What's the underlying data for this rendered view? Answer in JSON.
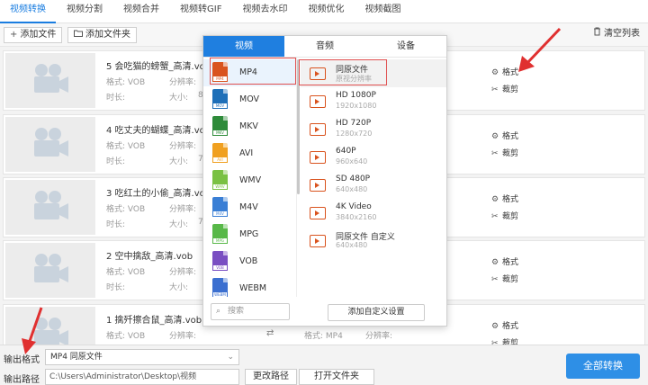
{
  "tabs": [
    "视频转换",
    "视频分割",
    "视频合并",
    "视频转GIF",
    "视频去水印",
    "视频优化",
    "视频截图"
  ],
  "toolbar": {
    "add_file": "添加文件",
    "add_folder": "添加文件夹",
    "clear_list": "清空列表"
  },
  "files": [
    {
      "name": "5 会吃猫的螃蟹_高清.vob",
      "format_label": "格式: VOB",
      "resolution_label": "分辨率:",
      "duration_label": "时长:",
      "size_label": "大小:",
      "size_partial": "8"
    },
    {
      "name": "4 吃丈夫的蝴蝶_高清.vob",
      "format_label": "格式: VOB",
      "resolution_label": "分辨率:",
      "duration_label": "时长:",
      "size_label": "大小:",
      "size_partial": "7"
    },
    {
      "name": "3 吃红土的小偷_高清.vob",
      "format_label": "格式: VOB",
      "resolution_label": "分辨率:",
      "duration_label": "时长:",
      "size_label": "大小:",
      "size_partial": "7"
    },
    {
      "name": "2 空中擒敌_高清.vob",
      "format_label": "格式: VOB",
      "resolution_label": "分辨率:",
      "duration_label": "时长:",
      "size_label": "大小:",
      "size_partial": ""
    },
    {
      "name": "1 擒歼擦合鼠_高清.vob",
      "format_label": "格式: VOB",
      "resolution_label": "分辨率:",
      "duration_label": "",
      "size_label": "",
      "size_partial": "",
      "out_format": "格式: MP4",
      "out_resolution": "分辨率:"
    }
  ],
  "row_actions": {
    "format": "格式",
    "trim": "裁剪"
  },
  "popup": {
    "tabs": [
      "视频",
      "音频",
      "设备"
    ],
    "formats": [
      {
        "label": "MP4",
        "color": "#d9531e"
      },
      {
        "label": "MOV",
        "color": "#1e6fb8"
      },
      {
        "label": "MKV",
        "color": "#2e8b3a"
      },
      {
        "label": "AVI",
        "color": "#f0a020"
      },
      {
        "label": "WMV",
        "color": "#7ac143"
      },
      {
        "label": "M4V",
        "color": "#3a7fd5"
      },
      {
        "label": "MPG",
        "color": "#58b848"
      },
      {
        "label": "VOB",
        "color": "#7a4fc2"
      },
      {
        "label": "WEBM",
        "color": "#3b6fd0"
      }
    ],
    "qualities": [
      {
        "title": "同原文件",
        "sub": "原视分辨率"
      },
      {
        "title": "HD 1080P",
        "sub": "1920x1080"
      },
      {
        "title": "HD 720P",
        "sub": "1280x720"
      },
      {
        "title": "640P",
        "sub": "960x640"
      },
      {
        "title": "SD 480P",
        "sub": "640x480"
      },
      {
        "title": "4K Video",
        "sub": "3840x2160"
      },
      {
        "title": "同原文件 自定义",
        "sub": "640x480"
      }
    ],
    "search_placeholder": "搜索",
    "custom_button": "添加自定义设置"
  },
  "bottom": {
    "output_format_label": "输出格式",
    "output_format_value": "MP4   同原文件",
    "output_path_label": "输出路径",
    "output_path_value": "C:\\Users\\Administrator\\Desktop\\视频",
    "change_path": "更改路径",
    "open_folder": "打开文件夹",
    "convert_all": "全部转换"
  },
  "colors": {
    "accent": "#1f7fe0",
    "annotation": "#e03030"
  }
}
